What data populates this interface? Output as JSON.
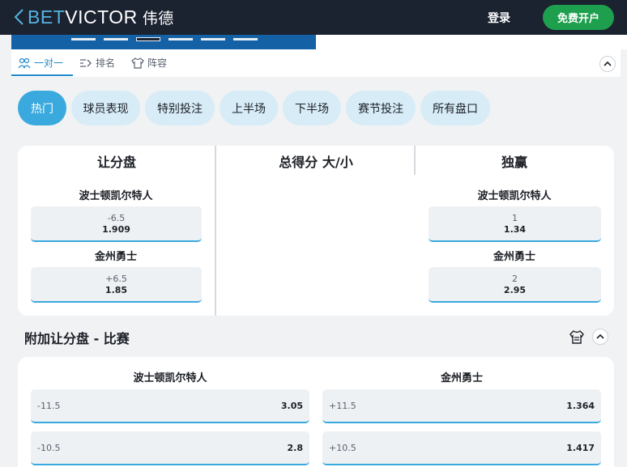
{
  "header": {
    "logo_bet": "BET",
    "logo_victor": "VICTOR",
    "logo_cn": "伟德",
    "login_label": "登录",
    "signup_label": "免费开户"
  },
  "subnav": {
    "items": [
      {
        "label": "一对一",
        "icon": "people-icon"
      },
      {
        "label": "排名",
        "icon": "ranking-icon"
      },
      {
        "label": "阵容",
        "icon": "shirt-icon"
      }
    ]
  },
  "tabs": [
    {
      "label": "热门",
      "active": true
    },
    {
      "label": "球员表现"
    },
    {
      "label": "特别投注"
    },
    {
      "label": "上半场"
    },
    {
      "label": "下半场"
    },
    {
      "label": "赛节投注"
    },
    {
      "label": "所有盘口"
    }
  ],
  "main_market": {
    "columns": [
      "让分盘",
      "总得分 大/小",
      "独赢"
    ],
    "handicap": [
      {
        "team": "波士顿凯尔特人",
        "line": "-6.5",
        "price": "1.909"
      },
      {
        "team": "金州勇士",
        "line": "+6.5",
        "price": "1.85"
      }
    ],
    "moneyline": [
      {
        "team": "波士顿凯尔特人",
        "line": "1",
        "price": "1.34"
      },
      {
        "team": "金州勇士",
        "line": "2",
        "price": "2.95"
      }
    ]
  },
  "extra_handicap": {
    "title": "附加让分盘 - 比赛",
    "teams": [
      "波士顿凯尔特人",
      "金州勇士"
    ],
    "rows": [
      {
        "left_line": "-11.5",
        "left_price": "3.05",
        "right_line": "+11.5",
        "right_price": "1.364"
      },
      {
        "left_line": "-10.5",
        "left_price": "2.8",
        "right_line": "+10.5",
        "right_price": "1.417"
      }
    ]
  },
  "colors": {
    "header_bg": "#1b2230",
    "accent": "#3aa9de",
    "signup_green": "#1e9f4d"
  }
}
